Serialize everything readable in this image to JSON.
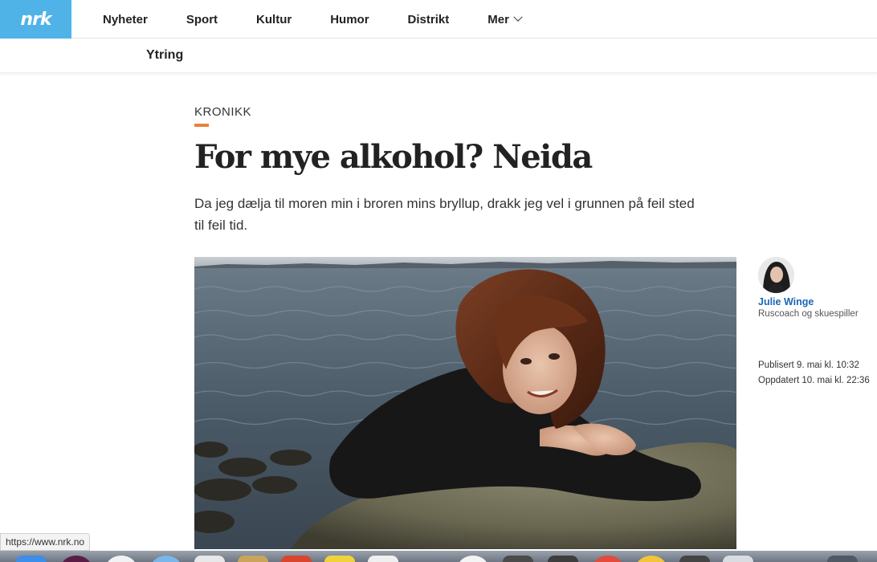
{
  "nav": {
    "logo": "nrk",
    "items": [
      "Nyheter",
      "Sport",
      "Kultur",
      "Humor",
      "Distrikt"
    ],
    "more_label": "Mer"
  },
  "subnav": {
    "label": "Ytring"
  },
  "article": {
    "kicker": "KRONIKK",
    "headline": "For mye alkohol? Neida",
    "lead": "Da jeg dælja til moren min i broren mins bryllup, drakk jeg vel i grunnen på feil sted til feil tid.",
    "image_alt": "Woman with auburn hair in a black sweater lying on a rock by the sea"
  },
  "author": {
    "name": "Julie Winge",
    "role": "Ruscoach og skuespiller"
  },
  "meta": {
    "published": "Publisert 9. mai kl. 10:32",
    "updated": "Oppdatert 10. mai kl. 22:36"
  },
  "status_bar": {
    "url": "https://www.nrk.no"
  },
  "dock": {
    "icons": [
      "finder-icon",
      "itunes-icon",
      "safari-icon",
      "launchpad-icon",
      "calendar-icon",
      "notes-icon",
      "stickies-icon",
      "text-icon",
      "photos-icon",
      "messages-icon",
      "facetime-icon",
      "chrome-icon",
      "maps-icon",
      "mail-icon",
      "preview-icon",
      "appstore-icon"
    ]
  },
  "colors": {
    "logo_bg": "#4fb3e8",
    "kicker_accent": "#e8813b",
    "author_link": "#1a67b5"
  }
}
